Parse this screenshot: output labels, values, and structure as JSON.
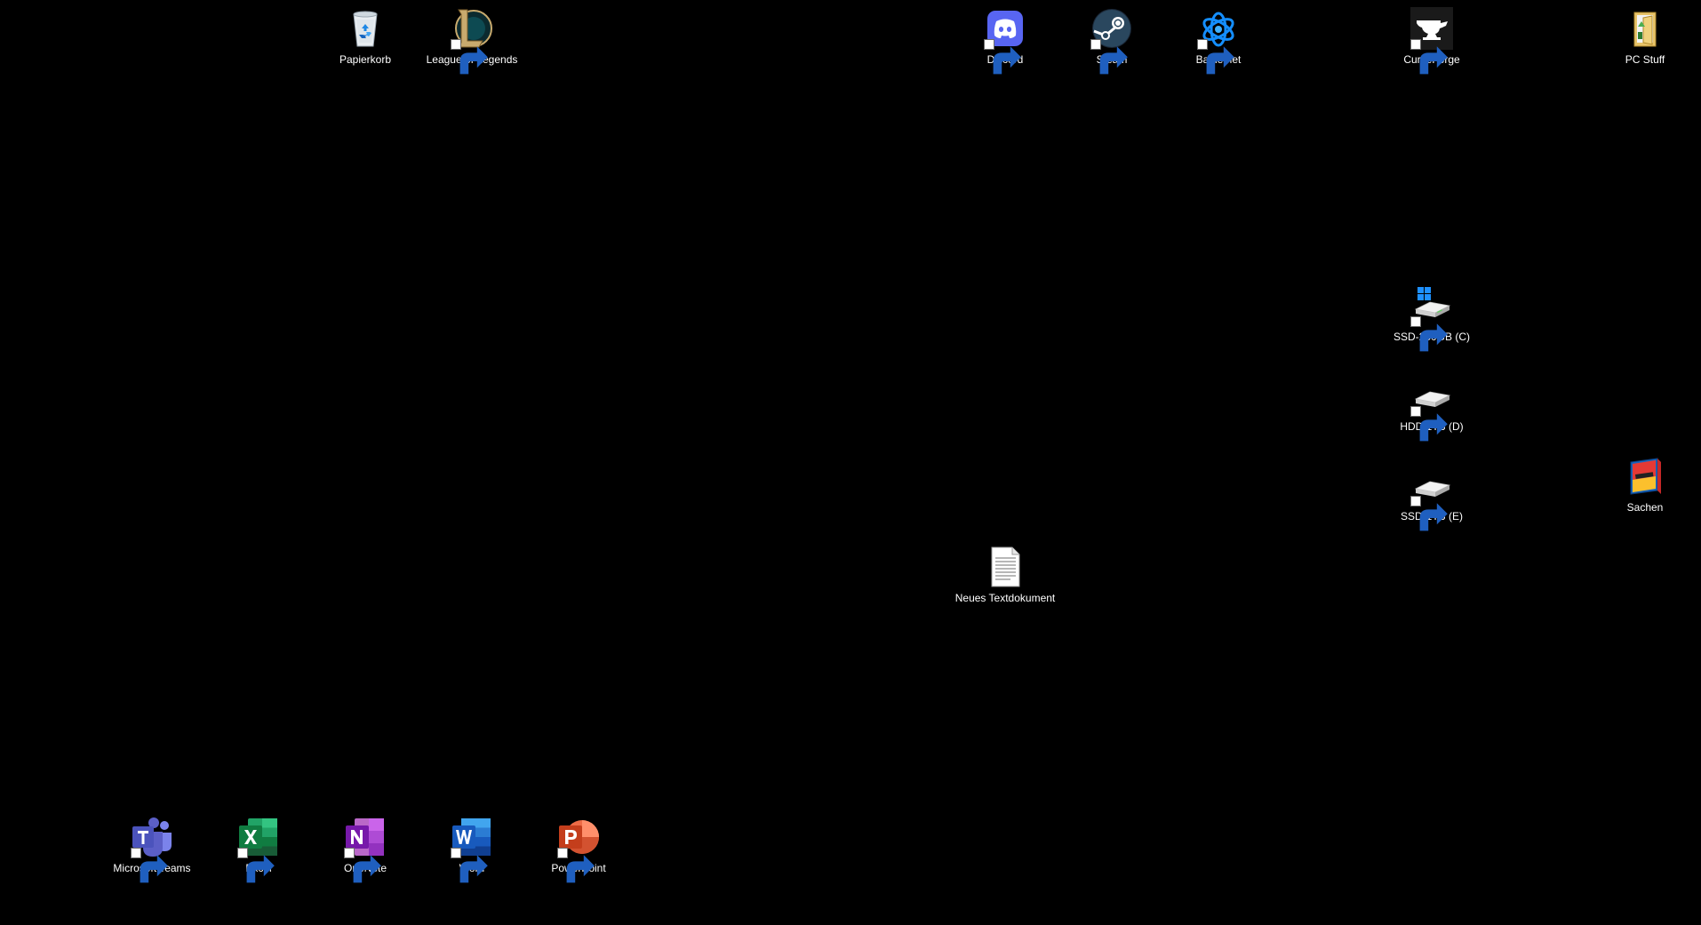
{
  "desktop": {
    "background_color": "#000000",
    "icons": {
      "papierkorb": {
        "label": "Papierkorb",
        "icon": "recycle-bin-icon"
      },
      "lol": {
        "label": "League of Legends",
        "icon": "league-of-legends-icon"
      },
      "discord": {
        "label": "Discord",
        "icon": "discord-icon",
        "color": "#5865F2"
      },
      "steam": {
        "label": "Steam",
        "icon": "steam-icon",
        "color": "#1b2838"
      },
      "battlenet": {
        "label": "Battle.net",
        "icon": "battlenet-icon",
        "color": "#148eff"
      },
      "curseforge": {
        "label": "CurseForge",
        "icon": "curseforge-icon"
      },
      "pcstuff": {
        "label": "PC Stuff",
        "icon": "folder-icon"
      },
      "ssd_c": {
        "label": "SSD-250GB (C)",
        "icon": "system-drive-icon"
      },
      "hdd_d": {
        "label": "HDD 1TB (D)",
        "icon": "drive-icon"
      },
      "ssd_e": {
        "label": "SSD-1TB (E)",
        "icon": "drive-icon"
      },
      "sachen": {
        "label": "Sachen",
        "icon": "book-folder-icon"
      },
      "textdoc": {
        "label": "Neues Textdokument",
        "icon": "text-document-icon"
      },
      "teams": {
        "label": "Microsoft Teams",
        "icon": "teams-icon",
        "color": "#5b5fc7"
      },
      "excel": {
        "label": "Excel",
        "icon": "excel-icon",
        "color": "#107c41"
      },
      "onenote": {
        "label": "OneNote",
        "icon": "onenote-icon",
        "color": "#7719aa"
      },
      "word": {
        "label": "Word",
        "icon": "word-icon",
        "color": "#185abd"
      },
      "powerpoint": {
        "label": "PowerPoint",
        "icon": "powerpoint-icon",
        "color": "#c43e1c"
      }
    }
  }
}
